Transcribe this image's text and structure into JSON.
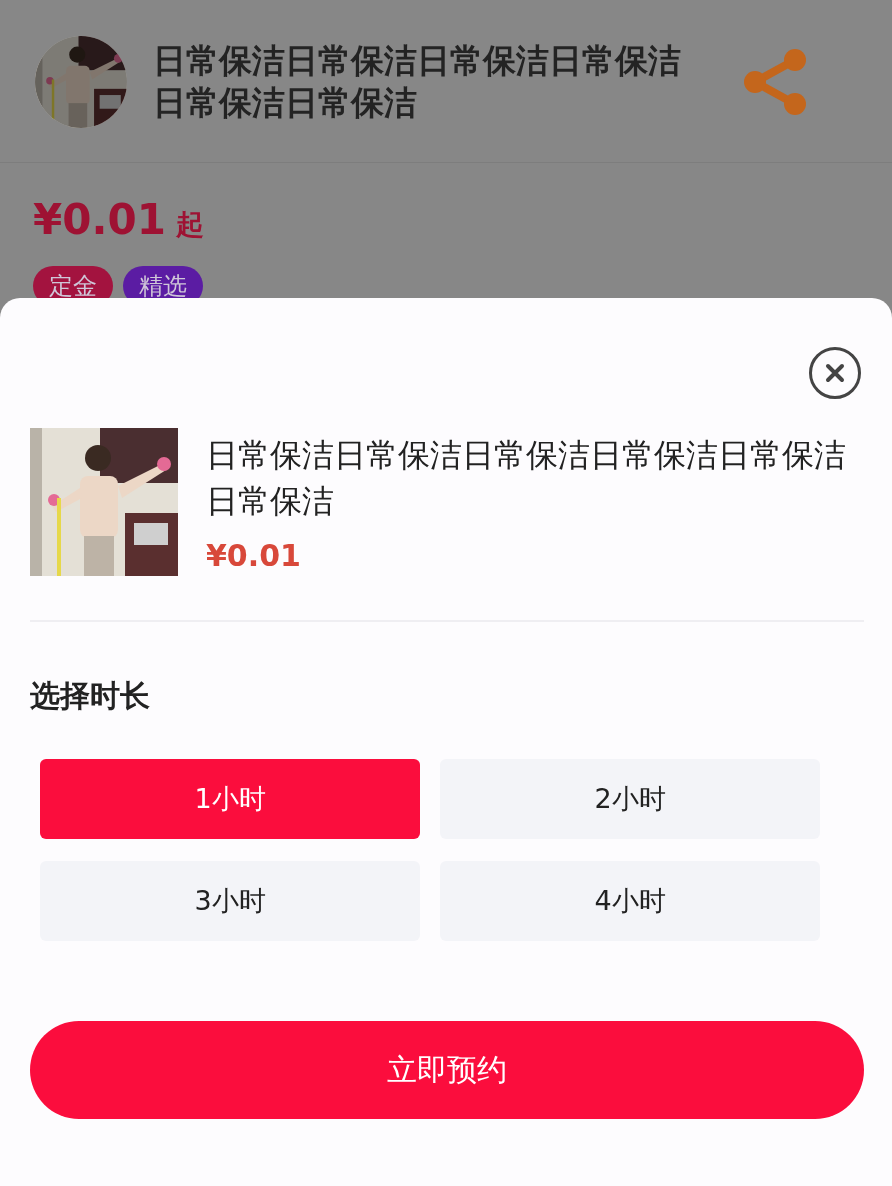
{
  "header": {
    "title": "日常保洁日常保洁日常保洁日常保洁日常保洁日常保洁",
    "price": "¥0.01",
    "price_suffix": "起",
    "tags": [
      {
        "label": "定金",
        "color": "#a3133f"
      },
      {
        "label": "精选",
        "color": "#5b1ca3"
      }
    ]
  },
  "sheet": {
    "product": {
      "title": "日常保洁日常保洁日常保洁日常保洁日常保洁日常保洁",
      "price": "¥0.01"
    },
    "section_title": "选择时长",
    "durations": [
      {
        "label": "1小时",
        "selected": true
      },
      {
        "label": "2小时",
        "selected": false
      },
      {
        "label": "3小时",
        "selected": false
      },
      {
        "label": "4小时",
        "selected": false
      }
    ],
    "book_button": "立即预约"
  }
}
